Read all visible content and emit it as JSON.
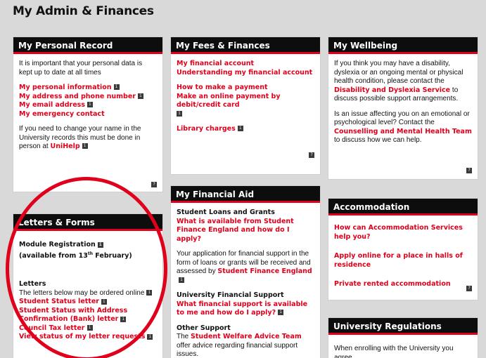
{
  "page": {
    "title": "My Admin & Finances"
  },
  "personal_record": {
    "heading": "My Personal Record",
    "intro": "It is important that your personal data is kept up to date at all times",
    "links": [
      "My personal information",
      "My address and phone number",
      "My email address",
      "My emergency contact"
    ],
    "change_name_text": "If you need to change your name in the University records this must be done in person at",
    "unihelp_link": "UniHelp"
  },
  "letters_forms": {
    "heading": "Letters & Forms",
    "module_registration": "Module Registration",
    "available_prefix": "(available from 13",
    "available_sup": "th",
    "available_suffix": " February)",
    "letters_heading": "Letters",
    "letters_intro": "The letters below may be ordered online",
    "links": [
      "Student Status letter",
      "Student Status with Address Confirmation (Bank) letter",
      "Council Tax letter",
      "View status of my letter requests"
    ]
  },
  "fees_finances": {
    "heading": "My Fees & Finances",
    "links_a": [
      "My financial account",
      "Understanding my financial account"
    ],
    "links_b": [
      "How to make a payment",
      "Make an online payment by debit/credit card"
    ],
    "library": "Library charges"
  },
  "financial_aid": {
    "heading": "My Financial Aid",
    "loans_heading": "Student Loans and Grants",
    "loans_link": "What is available from Student Finance England and how do I apply?",
    "application_text": "Your application for financial support in the form of loans or grants will be received and assessed by",
    "sfe_link": "Student Finance England",
    "uni_support_heading": "University Financial Support",
    "uni_support_link": "What financial support is available to me and how do I apply?",
    "other_heading": "Other Support",
    "other_text_prefix": "The",
    "welfare_link": "Student Welfare Advice Team",
    "other_text_suffix": "offer advice regarding financial support issues."
  },
  "wellbeing": {
    "heading": "My Wellbeing",
    "text1_prefix": "If you think you may have a disability, dyslexia or an ongoing mental or physical health condition, please contact the",
    "text1_link": "Disability and Dyslexia Service",
    "text1_suffix": "to discuss possible support arrangements.",
    "text2_prefix": "Is an issue affecting you on an emotional or psychological level? Contact the",
    "text2_link": "Counselling and Mental Health Team",
    "text2_suffix": "to discuss how we can help."
  },
  "accommodation": {
    "heading": "Accommodation",
    "links": [
      "How can Accommodation Services help you?",
      "Apply online for a place in halls of residence",
      "Private rented accommodation"
    ]
  },
  "regulations": {
    "heading": "University Regulations",
    "text": "When enrolling with the University you agree"
  },
  "icons": {
    "info_glyph": "i",
    "help_glyph": "?"
  },
  "colors": {
    "accent": "#e0001b",
    "header_bg": "#0d0d0d",
    "page_bg": "#d9d9d9"
  }
}
